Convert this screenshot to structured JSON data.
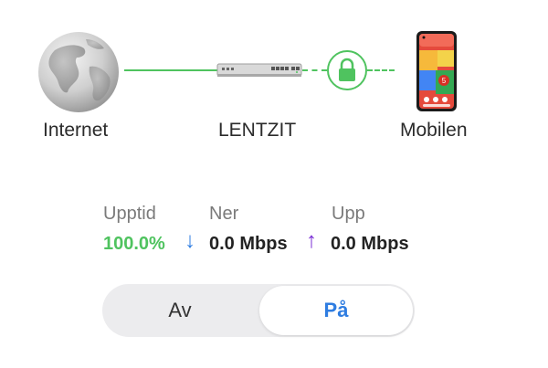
{
  "topology": {
    "internet_label": "Internet",
    "gateway_label": "LENTZIT",
    "client_label": "Mobilen",
    "phone_badge": "5",
    "link_color": "#4fc35f",
    "internet_icon": "globe-icon",
    "gateway_icon": "router-device-icon",
    "client_icon": "phone-device-icon",
    "secure_icon": "lock-icon"
  },
  "stats": {
    "uptime_label": "Upptid",
    "uptime_value": "100.0%",
    "down_label": "Ner",
    "down_value": "0.0 Mbps",
    "down_arrow": "↓",
    "up_label": "Upp",
    "up_value": "0.0 Mbps",
    "up_arrow": "↑",
    "uptime_color": "#4fc35f",
    "down_color": "#2f7de1",
    "up_color": "#7b2fd6"
  },
  "toggle": {
    "off_label": "Av",
    "on_label": "På",
    "selected": "on"
  }
}
